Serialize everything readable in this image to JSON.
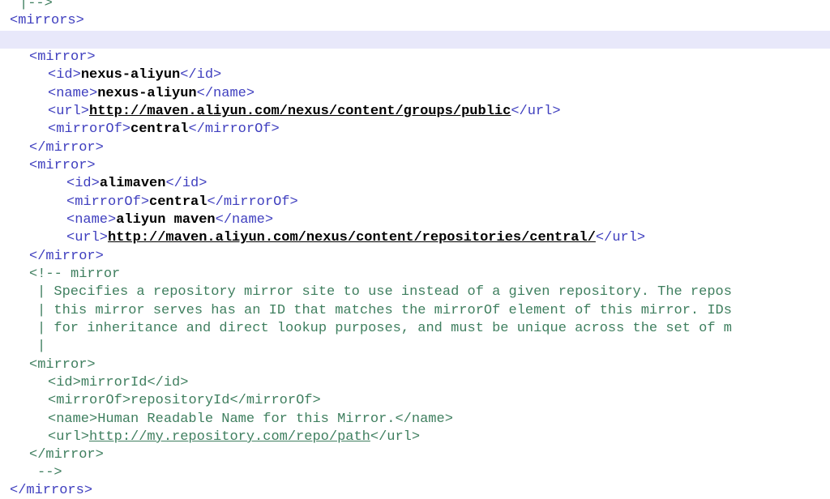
{
  "editor": {
    "colors": {
      "tag": "#3f3fbf",
      "comment": "#3f7f5f",
      "text": "#000000",
      "current_line": "#e8e8fa"
    },
    "lines": [
      {
        "text": "|-->"
      },
      {
        "open": "<mirrors>"
      },
      {
        "text": ""
      },
      {
        "open": "<mirror>"
      },
      {
        "open": "<id>",
        "value": "nexus-aliyun",
        "close": "</id>"
      },
      {
        "open": "<name>",
        "value": "nexus-aliyun",
        "close": "</name>"
      },
      {
        "open": "<url>",
        "value": "http://maven.aliyun.com/nexus/content/groups/public",
        "close": "</url>"
      },
      {
        "open": "<mirrorOf>",
        "value": "central",
        "close": "</mirrorOf>"
      },
      {
        "close": "</mirror>"
      },
      {
        "open": "<mirror>"
      },
      {
        "open": "<id>",
        "value": "alimaven",
        "close": "</id>"
      },
      {
        "open": "<mirrorOf>",
        "value": "central",
        "close": "</mirrorOf>"
      },
      {
        "open": "<name>",
        "value": "aliyun maven",
        "close": "</name>"
      },
      {
        "open": "<url>",
        "value": "http://maven.aliyun.com/nexus/content/repositories/central/",
        "close": "</url>"
      },
      {
        "close": "</mirror>"
      },
      {
        "text": "<!-- mirror"
      },
      {
        "text": "| Specifies a repository mirror site to use instead of a given repository. The repos"
      },
      {
        "text": "| this mirror serves has an ID that matches the mirrorOf element of this mirror. IDs"
      },
      {
        "text": "| for inheritance and direct lookup purposes, and must be unique across the set of m"
      },
      {
        "text": "|"
      },
      {
        "text": "<mirror>"
      },
      {
        "open": "<id>",
        "value": "mirrorId",
        "close": "</id>"
      },
      {
        "open": "<mirrorOf>",
        "value": "repositoryId",
        "close": "</mirrorOf>"
      },
      {
        "open": "<name>",
        "value": "Human Readable Name for this Mirror.",
        "close": "</name>"
      },
      {
        "open": "<url>",
        "value": "http://my.repository.com/repo/path",
        "close": "</url>"
      },
      {
        "text": "</mirror>"
      },
      {
        "text": "-->"
      },
      {
        "close": "</mirrors>"
      }
    ]
  }
}
